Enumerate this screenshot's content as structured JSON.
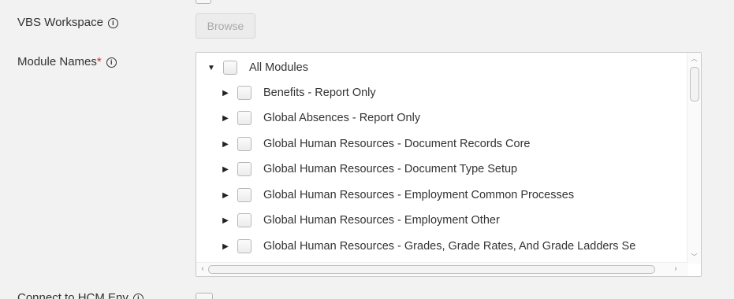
{
  "form": {
    "vbs_workspace": {
      "label": "VBS Workspace",
      "info_icon": "info-icon"
    },
    "browse_button": {
      "label": "Browse",
      "disabled": true
    },
    "module_names": {
      "label": "Module Names",
      "required_marker": "*",
      "info_icon": "info-icon"
    },
    "connect_to_hcm": {
      "label": "Connect to HCM Env",
      "info_icon": "info-icon"
    }
  },
  "tree": {
    "root": {
      "label": "All Modules",
      "expanded": true,
      "checked": false
    },
    "items": [
      {
        "label": "Benefits - Report Only",
        "expanded": false,
        "checked": false
      },
      {
        "label": "Global Absences - Report Only",
        "expanded": false,
        "checked": false
      },
      {
        "label": "Global Human Resources - Document Records Core",
        "expanded": false,
        "checked": false
      },
      {
        "label": "Global Human Resources - Document Type Setup",
        "expanded": false,
        "checked": false
      },
      {
        "label": "Global Human Resources - Employment Common Processes",
        "expanded": false,
        "checked": false
      },
      {
        "label": "Global Human Resources - Employment Other",
        "expanded": false,
        "checked": false
      },
      {
        "label": "Global Human Resources - Grades, Grade Rates, And Grade Ladders Se",
        "expanded": false,
        "checked": false
      }
    ]
  },
  "icons": {
    "expanded": "triangle-down-icon",
    "collapsed": "triangle-right-icon"
  }
}
